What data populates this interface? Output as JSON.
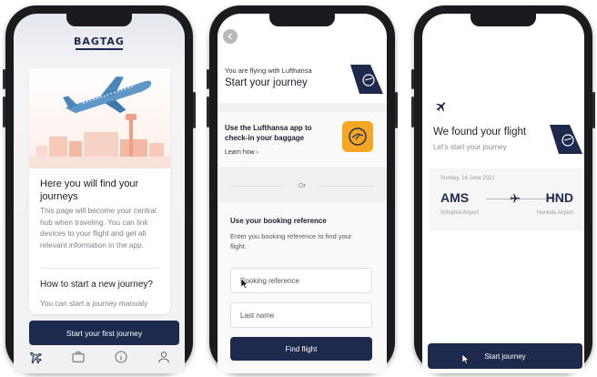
{
  "brand": {
    "logo_text": "BAGTAG",
    "navy": "#1d2a4d",
    "lufthansa_yellow": "#f5a623"
  },
  "screen1": {
    "card_title": "Here you will find your journeys",
    "card_text": "This page will become your central hub when traveling. You can link devices to your flight and get all relevant information in the app.",
    "section_title": "How to start a new journey?",
    "section_text": "You can start a journey manualy",
    "cta_label": "Start your first journey",
    "tabs": [
      {
        "icon": "airplane-icon"
      },
      {
        "icon": "suitcase-icon"
      },
      {
        "icon": "info-icon"
      },
      {
        "icon": "profile-icon"
      }
    ]
  },
  "screen2": {
    "flying_with": "You are flying with Lufthansa",
    "title": "Start your journey",
    "lufthansa_card": {
      "title": "Use the Lufthansa app to check-in your baggage",
      "link": "Learn how"
    },
    "or_label": "Or",
    "booking": {
      "title": "Use your booking reference",
      "description": "Enter you booking reference to find your flight.",
      "reference_placeholder": "Booking reference",
      "lastname_placeholder": "Last name",
      "cta_label": "Find flight"
    }
  },
  "screen3": {
    "title": "We found your flight",
    "subtitle": "Let's start your journey",
    "flight": {
      "date": "Sunday, 14 June 2021",
      "origin_code": "AMS",
      "origin_airport": "Schiphol Airport",
      "destination_code": "HND",
      "destination_airport": "Haneda Airport"
    },
    "cta_label": "Start journey"
  }
}
